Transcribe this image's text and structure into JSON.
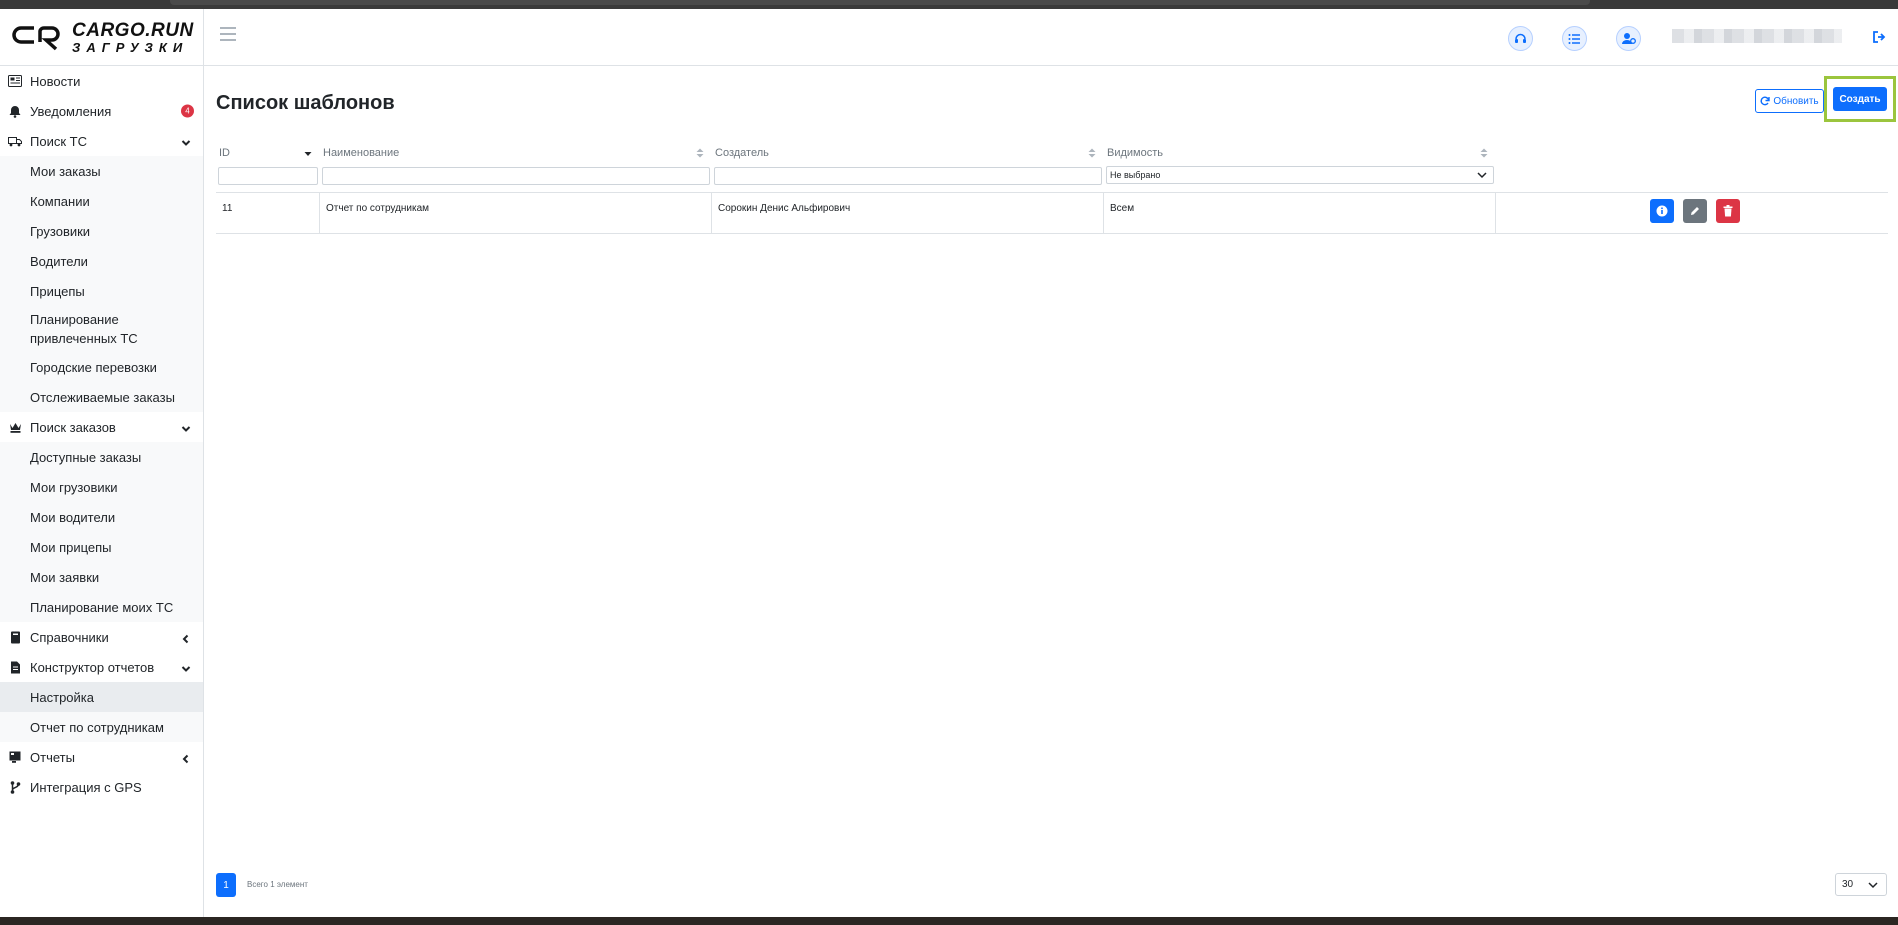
{
  "brand": {
    "line1": "CARGO.RUN",
    "line2": "ЗАГРУЗКИ"
  },
  "sidebar": {
    "items": [
      {
        "label": "Новости",
        "icon": "newspaper-icon"
      },
      {
        "label": "Уведомления",
        "icon": "bell-icon",
        "badge": "4"
      },
      {
        "label": "Поиск ТС",
        "icon": "truck-icon"
      },
      {
        "label": "Мои заказы"
      },
      {
        "label": "Компании"
      },
      {
        "label": "Грузовики"
      },
      {
        "label": "Водители"
      },
      {
        "label": "Прицепы"
      },
      {
        "label": "Планирование привлеченных ТС"
      },
      {
        "label": "Городские перевозки"
      },
      {
        "label": "Отслеживаемые заказы"
      },
      {
        "label": "Поиск заказов",
        "icon": "chess-queen-icon"
      },
      {
        "label": "Доступные заказы"
      },
      {
        "label": "Мои грузовики"
      },
      {
        "label": "Мои водители"
      },
      {
        "label": "Мои прицепы"
      },
      {
        "label": "Мои заявки"
      },
      {
        "label": "Планирование моих ТС"
      },
      {
        "label": "Справочники",
        "icon": "book-icon"
      },
      {
        "label": "Конструктор отчетов",
        "icon": "file-icon"
      },
      {
        "label": "Настройка"
      },
      {
        "label": "Отчет по сотрудникам"
      },
      {
        "label": "Отчеты",
        "icon": "report-icon"
      },
      {
        "label": "Интеграция с GPS",
        "icon": "branch-icon"
      }
    ]
  },
  "main": {
    "title": "Список шаблонов",
    "refresh_label": "Обновить",
    "create_label": "Создать",
    "columns": [
      "ID",
      "Наименование",
      "Создатель",
      "Видимость"
    ],
    "visibility_filter_value": "Не выбрано",
    "rows": [
      {
        "id": "11",
        "name": "Отчет по сотрудникам",
        "creator": "Сорокин Денис Альфирович",
        "visibility": "Всем"
      }
    ],
    "pagination": {
      "current_page": "1",
      "total_text": "Всего 1 элемент",
      "page_size": "30"
    }
  },
  "colors": {
    "primary": "#0d6efd",
    "danger": "#dc3545",
    "secondary": "#6c757d",
    "highlight": "#9bc53d"
  }
}
